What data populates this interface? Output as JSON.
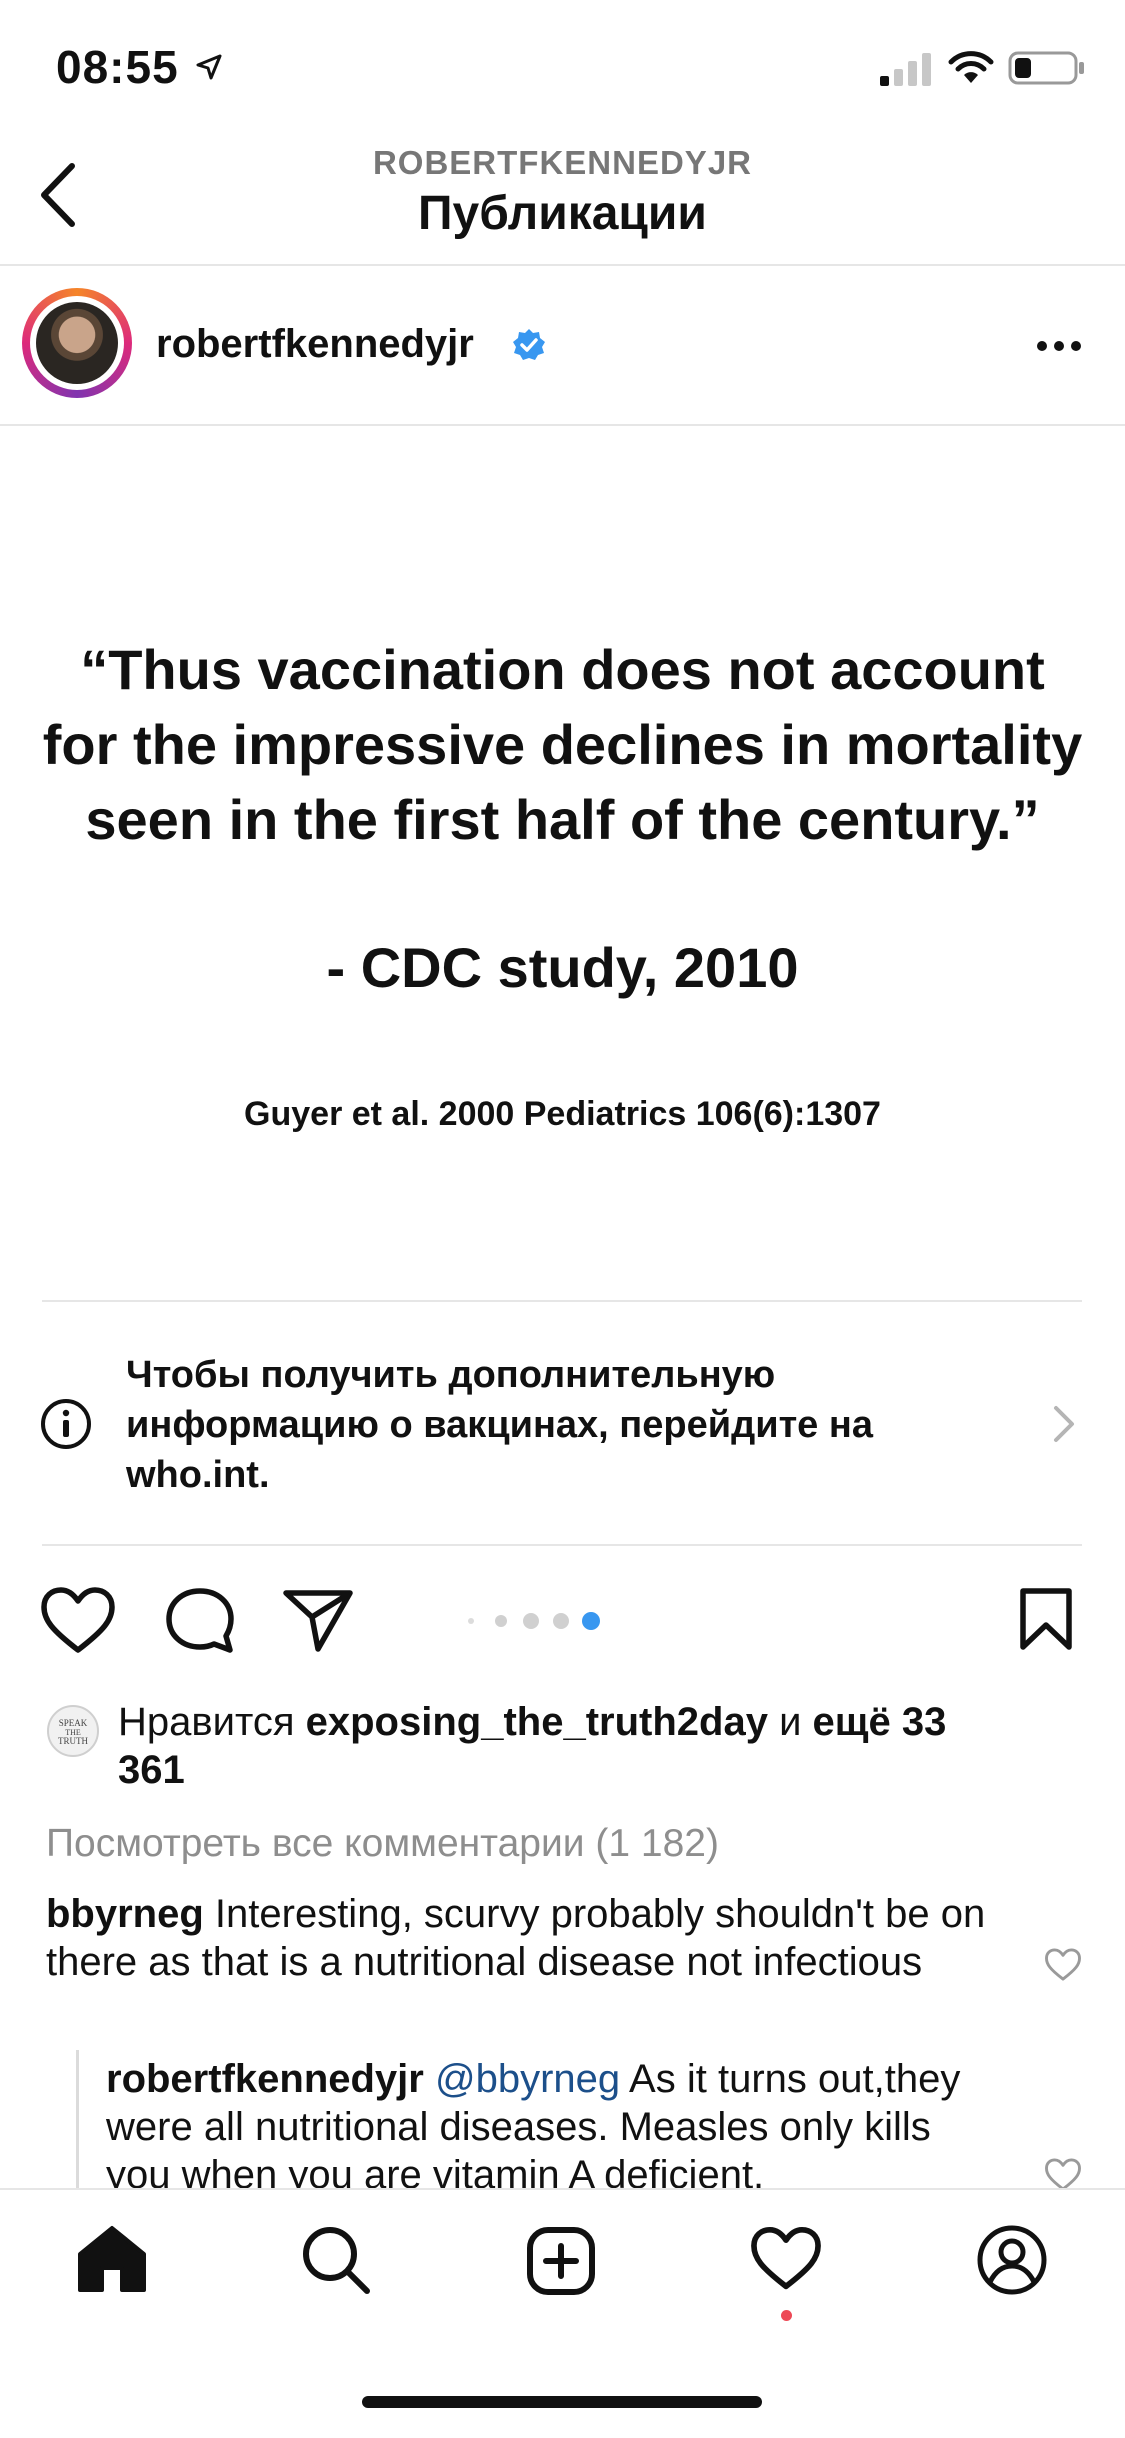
{
  "status_bar": {
    "time": "08:55"
  },
  "header": {
    "subtitle": "ROBERTFKENNEDYJR",
    "title": "Публикации"
  },
  "post": {
    "username": "robertfkennedyjr",
    "quote": "“Thus vaccination does not account for the impressive declines in mortality seen in the first half of the century.”",
    "attribution": "- CDC study, 2010",
    "citation": "Guyer et al. 2000 Pediatrics 106(6):1307",
    "carousel": {
      "count": 5,
      "active_index": 4
    }
  },
  "info_banner": {
    "text": "Чтобы получить дополнительную информацию о вакцинах, перейдите на who.int."
  },
  "likes": {
    "prefix": "Нравится ",
    "user": "exposing_the_truth2day",
    "middle": " и ",
    "more": "ещё 33 361"
  },
  "view_all_comments": "Посмотреть все комментарии (1 182)",
  "comments": [
    {
      "user": "bbyrneg",
      "text": " Interesting, scurvy probably shouldn't be on there as that is a nutritional disease not infectious"
    }
  ],
  "reply": {
    "user": "robertfkennedyjr",
    "mention": "@bbyrneg",
    "text": " As it turns out,they were all nutritional diseases. Measles only kills you when you are vitamin A deficient."
  },
  "colors": {
    "verified": "#3897f0",
    "active_dot": "#3897f0",
    "activity_dot": "#ed4956",
    "link": "#1c4f8a"
  }
}
